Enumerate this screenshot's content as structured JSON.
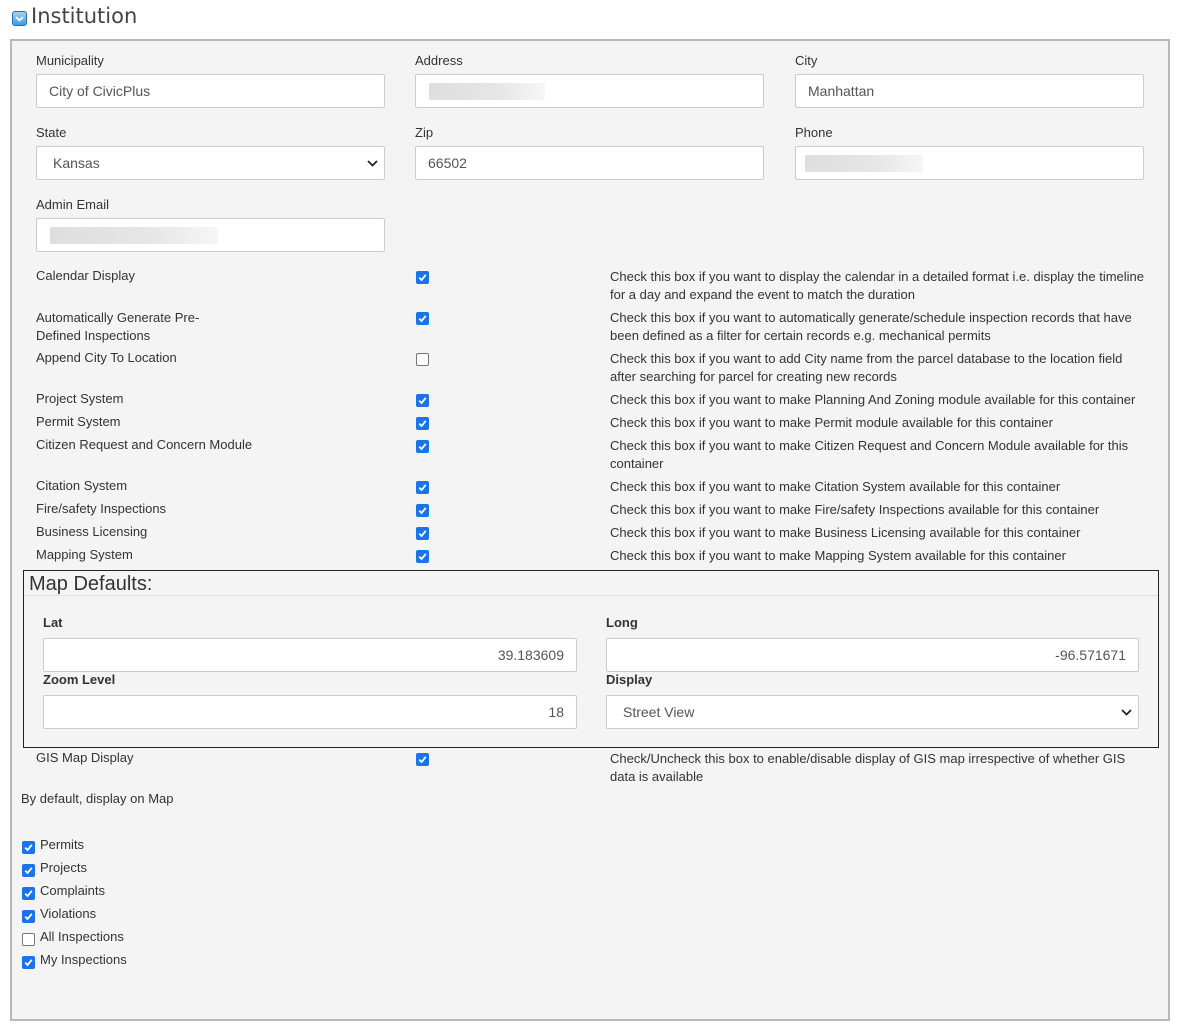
{
  "section_title": "Institution",
  "fields": {
    "municipality": {
      "label": "Municipality",
      "value": "City of CivicPlus"
    },
    "address": {
      "label": "Address",
      "value": ""
    },
    "city": {
      "label": "City",
      "value": "Manhattan"
    },
    "state": {
      "label": "State",
      "value": "Kansas"
    },
    "zip": {
      "label": "Zip",
      "value": "66502"
    },
    "phone": {
      "label": "Phone",
      "value": ""
    },
    "admin_email": {
      "label": "Admin Email",
      "value": ""
    }
  },
  "options": [
    {
      "label": "Calendar Display",
      "checked": true,
      "help": "Check this box if you want to display the calendar in a detailed format i.e. display the timeline for a day and expand the event to match the duration"
    },
    {
      "label": "Automatically Generate Pre-Defined Inspections",
      "checked": true,
      "help": "Check this box if you want to automatically generate/schedule inspection records that have been defined as a filter for certain records e.g. mechanical permits"
    },
    {
      "label": "Append City To Location",
      "checked": false,
      "help": "Check this box if you want to add City name from the parcel database to the location field after searching for parcel for creating new records"
    },
    {
      "label": "Project System",
      "checked": true,
      "help": "Check this box if you want to make Planning And Zoning module available for this container"
    },
    {
      "label": "Permit System",
      "checked": true,
      "help": "Check this box if you want to make Permit module available for this container"
    },
    {
      "label": "Citizen Request and Concern Module",
      "checked": true,
      "help": "Check this box if you want to make Citizen Request and Concern Module available for this container"
    },
    {
      "label": "Citation System",
      "checked": true,
      "help": "Check this box if you want to make Citation System available for this container"
    },
    {
      "label": "Fire/safety Inspections",
      "checked": true,
      "help": "Check this box if you want to make Fire/safety Inspections available for this container"
    },
    {
      "label": "Business Licensing",
      "checked": true,
      "help": "Check this box if you want to make Business Licensing available for this container"
    },
    {
      "label": "Mapping System",
      "checked": true,
      "help": "Check this box if you want to make Mapping System available for this container"
    }
  ],
  "map_defaults": {
    "title": "Map Defaults:",
    "lat_label": "Lat",
    "lat": "39.183609",
    "long_label": "Long",
    "long": "-96.571671",
    "zoom_label": "Zoom Level",
    "zoom": "18",
    "display_label": "Display",
    "display": "Street View"
  },
  "gis": {
    "label": "GIS Map Display",
    "checked": true,
    "help": "Check/Uncheck this box to enable/disable display of GIS map irrespective of whether GIS data is available"
  },
  "default_display": {
    "label": "By default, display on Map",
    "items": [
      {
        "label": "Permits",
        "checked": true
      },
      {
        "label": "Projects",
        "checked": true
      },
      {
        "label": "Complaints",
        "checked": true
      },
      {
        "label": "Violations",
        "checked": true
      },
      {
        "label": "All Inspections",
        "checked": false
      },
      {
        "label": "My Inspections",
        "checked": true
      }
    ]
  },
  "colors": {
    "accent": "#1a73e8",
    "panel_bg": "#f4f4f4",
    "border": "#b8b8b8"
  },
  "icons": {
    "toggle": "chevron-down-icon",
    "check": "check-icon",
    "dropdown": "chevron-down-icon"
  }
}
